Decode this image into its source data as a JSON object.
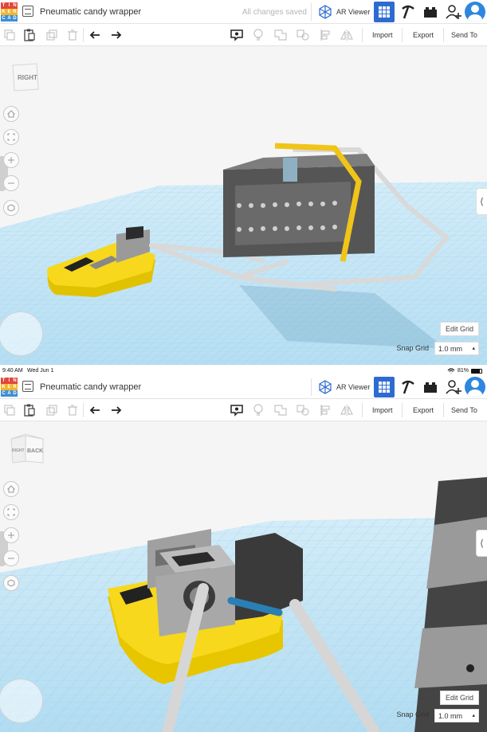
{
  "status_bar": {
    "time": "9:40 AM",
    "date": "Wed Jun 1",
    "battery": "81%"
  },
  "app": {
    "logo_letters": [
      "T",
      "I",
      "N",
      "K",
      "E",
      "R",
      "C",
      "A",
      "D"
    ],
    "logo_colors": [
      "#e2463a",
      "#e2463a",
      "#e2463a",
      "#f4b42a",
      "#f4b42a",
      "#f4b42a",
      "#3b8fd6",
      "#3b8fd6",
      "#3b8fd6"
    ],
    "accent": "#2d6bd1"
  },
  "panel_a": {
    "design_title": "Pneumatic candy wrapper",
    "save_status": "All changes saved",
    "ar_viewer_label": "AR Viewer",
    "import_label": "Import",
    "export_label": "Export",
    "send_to_label": "Send To",
    "viewcube_face": "RIGHT",
    "edit_grid_label": "Edit Grid",
    "snap_grid_label": "Snap Grid",
    "snap_grid_value": "1.0 mm"
  },
  "panel_b": {
    "design_title": "Pneumatic candy wrapper",
    "ar_viewer_label": "AR Viewer",
    "import_label": "Import",
    "export_label": "Export",
    "send_to_label": "Send To",
    "viewcube_faces": [
      "RIGHT",
      "BACK"
    ],
    "edit_grid_label": "Edit Grid",
    "snap_grid_label": "Snap Grid",
    "snap_grid_value": "1.0 mm"
  },
  "icons": {
    "toolbar_left": [
      "copy-icon",
      "paste-icon",
      "duplicate-icon",
      "delete-icon",
      "undo-icon",
      "redo-icon"
    ],
    "toolbar_mid": [
      "notes-icon",
      "light-bulb-icon",
      "group-icon",
      "ungroup-icon",
      "align-icon",
      "mirror-icon"
    ],
    "topbar_right": [
      "ar-viewer-icon",
      "grid-view-icon",
      "pickaxe-icon",
      "bricks-icon",
      "add-user-icon",
      "avatar"
    ],
    "nav": [
      "home-icon",
      "fit-view-icon",
      "zoom-in-icon",
      "zoom-out-icon",
      "ortho-view-icon"
    ]
  }
}
